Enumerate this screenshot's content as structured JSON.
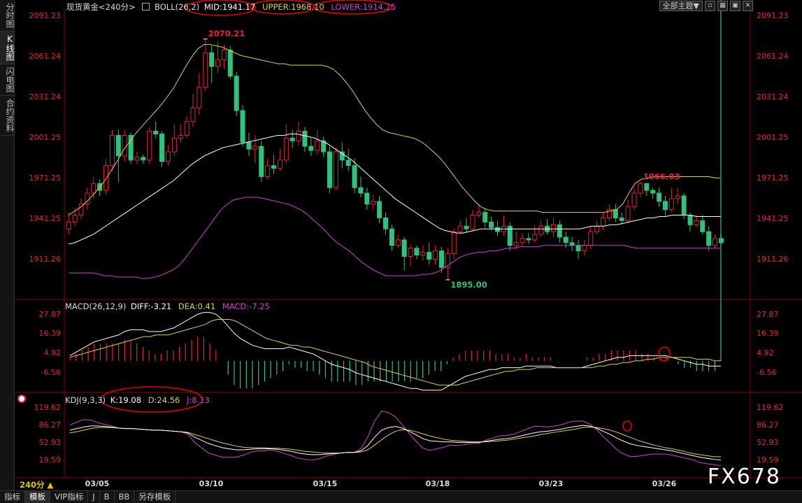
{
  "side_tabs": [
    "分时图",
    "K线图",
    "闪电图",
    "合约资料"
  ],
  "side_tab_active": 1,
  "header": {
    "title": "现货黄金<240分>",
    "boll": "BOLL(26,2)",
    "mid": "MID:1941.17",
    "upper": "UPPER:1968.10",
    "lower": "LOWER:1914.25",
    "theme_button": "全部主题▼"
  },
  "macd_header": {
    "name": "MACD(26,12,9)",
    "diff": "DIFF:-3.21",
    "dea": "DEA:0.41",
    "macd": "MACD:-7.25"
  },
  "kdj_header": {
    "name": "KDJ(9,3,3)",
    "k": "K:19.08",
    "d": "D:24.56",
    "j": "J:8.13"
  },
  "price_axis": [
    "2091.23",
    "2061.24",
    "2031.24",
    "2001.25",
    "1971.25",
    "1941.25",
    "1911.26"
  ],
  "macd_axis": [
    "27.87",
    "16.39",
    "4.92",
    "-6.56"
  ],
  "kdj_axis": [
    "119.62",
    "86.27",
    "52.93",
    "19.59"
  ],
  "price_annotations": {
    "high": "2070.21",
    "low": "1895.00",
    "mid_high": "1966.03"
  },
  "dates": [
    "03/05",
    "03/10",
    "03/15",
    "03/18",
    "03/23",
    "03/26"
  ],
  "period_label": "240分 ▲",
  "bottom_tabs": [
    "指标",
    "模板",
    "VIP指标",
    "J",
    "B",
    "BB",
    "另存模板"
  ],
  "bottom_tab_active": 1,
  "watermark": "FX678",
  "colors": {
    "up": "#e8203a",
    "down": "#2fc27e",
    "mid": "#ffffff",
    "upper": "#e0d040",
    "lower": "#d040d0",
    "axis_text": "#e8203a",
    "annotation_circle": "#e00000"
  },
  "chart_data": {
    "type": "candlestick",
    "bars": [
      [
        1932,
        1937,
        1944,
        1928
      ],
      [
        1937,
        1942,
        1947,
        1934
      ],
      [
        1942,
        1950,
        1954,
        1939
      ],
      [
        1950,
        1958,
        1962,
        1946
      ],
      [
        1958,
        1965,
        1970,
        1954
      ],
      [
        1965,
        1960,
        1968,
        1956
      ],
      [
        1960,
        1978,
        1983,
        1957
      ],
      [
        1978,
        2000,
        2004,
        1974
      ],
      [
        2000,
        1985,
        2004,
        1966
      ],
      [
        1985,
        2000,
        2004,
        1981
      ],
      [
        2000,
        1982,
        2002,
        1979
      ],
      [
        1982,
        1984,
        1988,
        1979
      ],
      [
        1984,
        1982,
        1986,
        1979
      ],
      [
        1982,
        2003,
        2006,
        1979
      ],
      [
        2003,
        2001,
        2010,
        1998
      ],
      [
        2001,
        1981,
        2003,
        1977
      ],
      [
        1981,
        1988,
        1993,
        1978
      ],
      [
        1988,
        1998,
        2008,
        1985
      ],
      [
        1998,
        2000,
        2008,
        1995
      ],
      [
        2000,
        2010,
        2014,
        1998
      ],
      [
        2010,
        2020,
        2030,
        2006
      ],
      [
        2020,
        2035,
        2045,
        2015
      ],
      [
        2035,
        2060,
        2070,
        2032
      ],
      [
        2060,
        2050,
        2065,
        2038
      ],
      [
        2050,
        2055,
        2068,
        2045
      ],
      [
        2055,
        2062,
        2066,
        2048
      ],
      [
        2062,
        2043,
        2065,
        2041
      ],
      [
        2043,
        2018,
        2046,
        2014
      ],
      [
        2018,
        1995,
        2022,
        1992
      ],
      [
        1995,
        1990,
        2002,
        1985
      ],
      [
        1990,
        1992,
        2000,
        1980
      ],
      [
        1992,
        1970,
        1996,
        1966
      ],
      [
        1970,
        1978,
        1983,
        1968
      ],
      [
        1978,
        1976,
        1986,
        1972
      ],
      [
        1976,
        1982,
        1990,
        1974
      ],
      [
        1982,
        1998,
        2008,
        1979
      ],
      [
        1998,
        1996,
        2004,
        1991
      ],
      [
        1996,
        2003,
        2010,
        1993
      ],
      [
        2003,
        1992,
        2006,
        1988
      ],
      [
        1992,
        1989,
        1998,
        1985
      ],
      [
        1989,
        1996,
        2004,
        1986
      ],
      [
        1996,
        1988,
        1999,
        1984
      ],
      [
        1988,
        1962,
        1992,
        1958
      ],
      [
        1962,
        1988,
        1991,
        1960
      ],
      [
        1988,
        1982,
        1995,
        1976
      ],
      [
        1982,
        1978,
        1990,
        1974
      ],
      [
        1978,
        1962,
        1983,
        1958
      ],
      [
        1962,
        1958,
        1970,
        1955
      ],
      [
        1958,
        1950,
        1962,
        1946
      ],
      [
        1950,
        1952,
        1957,
        1946
      ],
      [
        1952,
        1940,
        1956,
        1936
      ],
      [
        1940,
        1932,
        1944,
        1928
      ],
      [
        1932,
        1920,
        1935,
        1916
      ],
      [
        1920,
        1924,
        1928,
        1918
      ],
      [
        1924,
        1912,
        1926,
        1902
      ],
      [
        1912,
        1918,
        1921,
        1905
      ],
      [
        1918,
        1913,
        1920,
        1910
      ],
      [
        1913,
        1915,
        1920,
        1909
      ],
      [
        1915,
        1910,
        1922,
        1906
      ],
      [
        1910,
        1916,
        1920,
        1906
      ],
      [
        1916,
        1904,
        1919,
        1900
      ],
      [
        1904,
        1914,
        1918,
        1895
      ],
      [
        1914,
        1930,
        1932,
        1910
      ],
      [
        1930,
        1934,
        1938,
        1928
      ],
      [
        1934,
        1932,
        1940,
        1929
      ],
      [
        1932,
        1942,
        1946,
        1930
      ],
      [
        1942,
        1944,
        1950,
        1940
      ],
      [
        1944,
        1937,
        1947,
        1933
      ],
      [
        1937,
        1933,
        1941,
        1931
      ],
      [
        1933,
        1930,
        1938,
        1927
      ],
      [
        1930,
        1934,
        1942,
        1927
      ],
      [
        1934,
        1920,
        1937,
        1916
      ],
      [
        1920,
        1922,
        1930,
        1917
      ],
      [
        1922,
        1925,
        1929,
        1919
      ],
      [
        1925,
        1924,
        1929,
        1921
      ],
      [
        1924,
        1928,
        1934,
        1922
      ],
      [
        1928,
        1934,
        1938,
        1926
      ],
      [
        1934,
        1930,
        1939,
        1928
      ],
      [
        1930,
        1935,
        1940,
        1926
      ],
      [
        1935,
        1926,
        1938,
        1922
      ],
      [
        1926,
        1922,
        1930,
        1918
      ],
      [
        1922,
        1920,
        1926,
        1916
      ],
      [
        1920,
        1916,
        1924,
        1910
      ],
      [
        1916,
        1920,
        1924,
        1912
      ],
      [
        1920,
        1930,
        1934,
        1917
      ],
      [
        1930,
        1934,
        1938,
        1928
      ],
      [
        1934,
        1940,
        1944,
        1931
      ],
      [
        1940,
        1946,
        1950,
        1938
      ],
      [
        1946,
        1940,
        1950,
        1937
      ],
      [
        1940,
        1938,
        1944,
        1935
      ],
      [
        1938,
        1948,
        1953,
        1936
      ],
      [
        1948,
        1958,
        1962,
        1946
      ],
      [
        1958,
        1965,
        1966,
        1955
      ],
      [
        1965,
        1960,
        1964,
        1956
      ],
      [
        1960,
        1958,
        1962,
        1954
      ],
      [
        1958,
        1952,
        1962,
        1948
      ],
      [
        1952,
        1946,
        1956,
        1941
      ],
      [
        1946,
        1954,
        1962,
        1944
      ],
      [
        1954,
        1956,
        1962,
        1950
      ],
      [
        1956,
        1942,
        1958,
        1939
      ],
      [
        1942,
        1935,
        1944,
        1930
      ],
      [
        1935,
        1938,
        1942,
        1933
      ],
      [
        1938,
        1930,
        1942,
        1928
      ],
      [
        1930,
        1920,
        1934,
        1916
      ],
      [
        1920,
        1925,
        1928,
        1918
      ],
      [
        1925,
        1922,
        1928,
        1920
      ]
    ],
    "upper": [
      1942,
      1945,
      1948,
      1952,
      1957,
      1962,
      1968,
      1975,
      1982,
      1990,
      1996,
      2002,
      2007,
      2012,
      2017,
      2022,
      2028,
      2034,
      2042,
      2050,
      2057,
      2063,
      2066,
      2066,
      2065,
      2064,
      2062,
      2060,
      2058,
      2057,
      2056,
      2055,
      2054,
      2053,
      2052,
      2052,
      2051,
      2051,
      2051,
      2051,
      2051,
      2051,
      2050,
      2048,
      2044,
      2039,
      2033,
      2026,
      2019,
      2013,
      2008,
      2004,
      2002,
      2001,
      2000,
      1999,
      1998,
      1996,
      1993,
      1989,
      1985,
      1980,
      1974,
      1968,
      1962,
      1957,
      1952,
      1948,
      1946,
      1945,
      1945,
      1945,
      1945,
      1945,
      1945,
      1945,
      1945,
      1944,
      1944,
      1944,
      1944,
      1944,
      1944,
      1944,
      1944,
      1944,
      1944,
      1944,
      1945,
      1946,
      1950,
      1958,
      1965,
      1968,
      1969,
      1970,
      1970,
      1970,
      1970,
      1970,
      1970,
      1970,
      1970,
      1970,
      1970,
      1969,
      1969
    ],
    "mid": [
      1921,
      1922,
      1924,
      1926,
      1928,
      1931,
      1934,
      1937,
      1940,
      1943,
      1946,
      1949,
      1952,
      1955,
      1958,
      1961,
      1964,
      1967,
      1971,
      1975,
      1979,
      1982,
      1985,
      1987,
      1989,
      1991,
      1992,
      1993,
      1994,
      1995,
      1996,
      1997,
      1998,
      1999,
      2000,
      2000,
      2001,
      2001,
      2000,
      1999,
      1998,
      1996,
      1994,
      1991,
      1988,
      1985,
      1982,
      1978,
      1974,
      1970,
      1966,
      1962,
      1958,
      1954,
      1951,
      1948,
      1945,
      1942,
      1939,
      1936,
      1933,
      1931,
      1930,
      1929,
      1929,
      1930,
      1931,
      1932,
      1932,
      1932,
      1932,
      1932,
      1932,
      1932,
      1932,
      1932,
      1932,
      1932,
      1932,
      1932,
      1932,
      1932,
      1932,
      1932,
      1933,
      1934,
      1934,
      1934,
      1935,
      1935,
      1936,
      1937,
      1938,
      1939,
      1940,
      1940,
      1941,
      1941,
      1942,
      1942,
      1942,
      1942,
      1941,
      1941,
      1941,
      1941,
      1941
    ],
    "lower": [
      1900,
      1900,
      1900,
      1900,
      1900,
      1899,
      1898,
      1898,
      1897,
      1897,
      1897,
      1897,
      1896,
      1896,
      1897,
      1898,
      1900,
      1902,
      1905,
      1910,
      1916,
      1922,
      1928,
      1934,
      1940,
      1946,
      1950,
      1953,
      1954,
      1955,
      1955,
      1955,
      1954,
      1953,
      1952,
      1951,
      1950,
      1948,
      1946,
      1943,
      1939,
      1935,
      1931,
      1926,
      1922,
      1919,
      1916,
      1912,
      1908,
      1905,
      1902,
      1900,
      1898,
      1898,
      1898,
      1898,
      1898,
      1898,
      1899,
      1899,
      1900,
      1902,
      1905,
      1908,
      1911,
      1913,
      1914,
      1915,
      1915,
      1916,
      1916,
      1917,
      1918,
      1918,
      1919,
      1919,
      1919,
      1919,
      1920,
      1920,
      1920,
      1920,
      1920,
      1920,
      1920,
      1920,
      1920,
      1920,
      1920,
      1920,
      1920,
      1920,
      1919,
      1918,
      1918,
      1918,
      1918,
      1918,
      1918,
      1918,
      1918,
      1918,
      1918,
      1918,
      1918,
      1918,
      1918,
      1918
    ],
    "macd": {
      "diff": [
        3,
        5,
        7,
        9,
        11,
        12,
        13,
        14,
        15,
        17,
        18,
        18,
        18,
        17,
        17,
        17,
        18,
        19,
        21,
        23,
        25,
        27,
        28,
        28,
        27,
        24,
        20,
        16,
        13,
        11,
        9,
        8,
        7,
        7,
        7,
        7,
        8,
        7,
        6,
        5,
        4,
        2,
        0,
        -2,
        -3,
        -4,
        -5,
        -7,
        -8,
        -9,
        -10,
        -11,
        -12,
        -13,
        -14,
        -15,
        -16,
        -16,
        -17,
        -17,
        -17,
        -17,
        -15,
        -13,
        -11,
        -9,
        -8,
        -7,
        -6,
        -5,
        -5,
        -4,
        -4,
        -4,
        -4,
        -3,
        -3,
        -3,
        -3,
        -3,
        -4,
        -4,
        -4,
        -4,
        -4,
        -3,
        -2,
        -1,
        0,
        1,
        2,
        2,
        3,
        3,
        3,
        3,
        3,
        3,
        3,
        2,
        1,
        0,
        -1,
        -2,
        -2,
        -3,
        -3,
        -3
      ],
      "dea": [
        2,
        3,
        4,
        5,
        6,
        7,
        8,
        9,
        10,
        11,
        12,
        13,
        14,
        14,
        15,
        15,
        15,
        16,
        17,
        18,
        19,
        20,
        21,
        23,
        24,
        24,
        24,
        23,
        21,
        19,
        17,
        15,
        13,
        12,
        11,
        10,
        9,
        9,
        8,
        8,
        7,
        6,
        5,
        4,
        3,
        2,
        1,
        0,
        -1,
        -3,
        -4,
        -5,
        -6,
        -7,
        -8,
        -9,
        -10,
        -11,
        -12,
        -13,
        -14,
        -14,
        -14,
        -14,
        -13,
        -12,
        -11,
        -10,
        -9,
        -8,
        -7,
        -6,
        -6,
        -5,
        -5,
        -5,
        -4,
        -4,
        -4,
        -4,
        -4,
        -4,
        -4,
        -4,
        -4,
        -4,
        -3,
        -3,
        -2,
        -2,
        -1,
        -1,
        0,
        0,
        1,
        1,
        2,
        2,
        2,
        2,
        2,
        2,
        1,
        1,
        1,
        0,
        0
      ]
    },
    "kdj": {
      "k": [
        75,
        78,
        81,
        83,
        83,
        82,
        81,
        79,
        78,
        78,
        77,
        76,
        75,
        75,
        74,
        73,
        72,
        70,
        62,
        56,
        50,
        46,
        42,
        40,
        38,
        38,
        39,
        40,
        40,
        40,
        39,
        37,
        35,
        32,
        30,
        29,
        29,
        30,
        31,
        32,
        33,
        33,
        36,
        46,
        62,
        75,
        80,
        82,
        79,
        73,
        66,
        59,
        55,
        54,
        53,
        53,
        52,
        52,
        52,
        52,
        54,
        56,
        58,
        59,
        61,
        64,
        67,
        70,
        72,
        73,
        75,
        77,
        80,
        82,
        84,
        83,
        79,
        73,
        67,
        60,
        54,
        49,
        46,
        44,
        42,
        40,
        38,
        36,
        33,
        30,
        27,
        24,
        22,
        20,
        19
      ],
      "d": [
        70,
        72,
        75,
        78,
        80,
        80,
        80,
        79,
        78,
        78,
        77,
        76,
        75,
        75,
        74,
        73,
        72,
        71,
        67,
        63,
        59,
        55,
        51,
        48,
        45,
        43,
        42,
        42,
        42,
        41,
        41,
        40,
        39,
        37,
        35,
        34,
        33,
        32,
        32,
        32,
        33,
        33,
        34,
        38,
        47,
        57,
        66,
        73,
        76,
        75,
        72,
        68,
        64,
        61,
        58,
        56,
        55,
        54,
        53,
        53,
        53,
        54,
        55,
        56,
        58,
        60,
        62,
        64,
        67,
        69,
        71,
        73,
        75,
        77,
        80,
        81,
        80,
        78,
        75,
        71,
        66,
        61,
        56,
        52,
        48,
        45,
        42,
        40,
        37,
        34,
        31,
        29,
        27,
        25,
        25
      ],
      "j": [
        85,
        90,
        95,
        94,
        89,
        86,
        83,
        79,
        78,
        78,
        77,
        76,
        75,
        75,
        74,
        73,
        72,
        68,
        52,
        42,
        32,
        28,
        24,
        24,
        24,
        28,
        33,
        36,
        36,
        38,
        35,
        31,
        27,
        22,
        20,
        19,
        21,
        26,
        29,
        32,
        33,
        33,
        40,
        62,
        92,
        111,
        108,
        100,
        85,
        69,
        54,
        41,
        37,
        40,
        43,
        47,
        46,
        48,
        50,
        50,
        56,
        60,
        64,
        65,
        67,
        72,
        77,
        82,
        82,
        81,
        83,
        85,
        90,
        92,
        92,
        87,
        77,
        63,
        51,
        38,
        30,
        25,
        26,
        28,
        30,
        30,
        30,
        28,
        25,
        22,
        19,
        14,
        12,
        10,
        8
      ]
    }
  }
}
